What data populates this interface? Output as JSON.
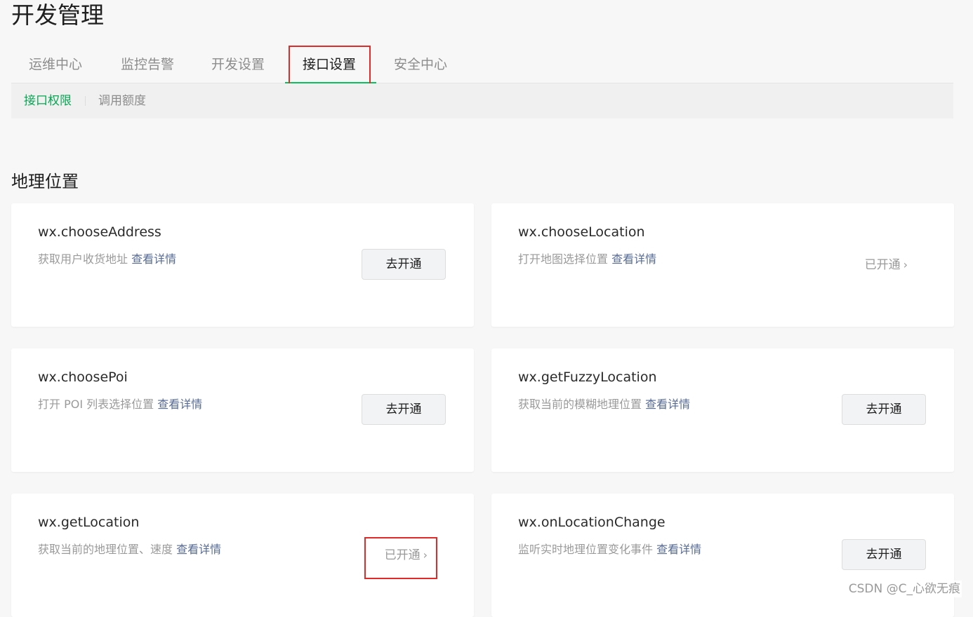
{
  "page": {
    "title": "开发管理"
  },
  "tabs": [
    {
      "label": "运维中心"
    },
    {
      "label": "监控告警"
    },
    {
      "label": "开发设置"
    },
    {
      "label": "接口设置"
    },
    {
      "label": "安全中心"
    }
  ],
  "active_tab": "接口设置",
  "subnav": [
    {
      "label": "接口权限"
    },
    {
      "label": "调用额度"
    }
  ],
  "active_subnav": "接口权限",
  "section": {
    "title": "地理位置"
  },
  "cards": [
    {
      "name": "wx.chooseAddress",
      "desc": "获取用户收货地址",
      "link": "查看详情",
      "action": "去开通",
      "status": "closed"
    },
    {
      "name": "wx.chooseLocation",
      "desc": "打开地图选择位置",
      "link": "查看详情",
      "action": "已开通",
      "status": "opened"
    },
    {
      "name": "wx.choosePoi",
      "desc": "打开 POI 列表选择位置",
      "link": "查看详情",
      "action": "去开通",
      "status": "closed"
    },
    {
      "name": "wx.getFuzzyLocation",
      "desc": "获取当前的模糊地理位置",
      "link": "查看详情",
      "action": "去开通",
      "status": "closed"
    },
    {
      "name": "wx.getLocation",
      "desc": "获取当前的地理位置、速度",
      "link": "查看详情",
      "action": "已开通",
      "status": "opened"
    },
    {
      "name": "wx.onLocationChange",
      "desc": "监听实时地理位置变化事件",
      "link": "查看详情",
      "action": "去开通",
      "status": "closed"
    }
  ],
  "icons": {
    "chevron": "chevron-right-icon"
  },
  "colors": {
    "accent_green": "#07c160",
    "link_blue": "#576b95",
    "highlight_red": "#e02b2b"
  },
  "watermark": "CSDN @C_心欲无痕"
}
